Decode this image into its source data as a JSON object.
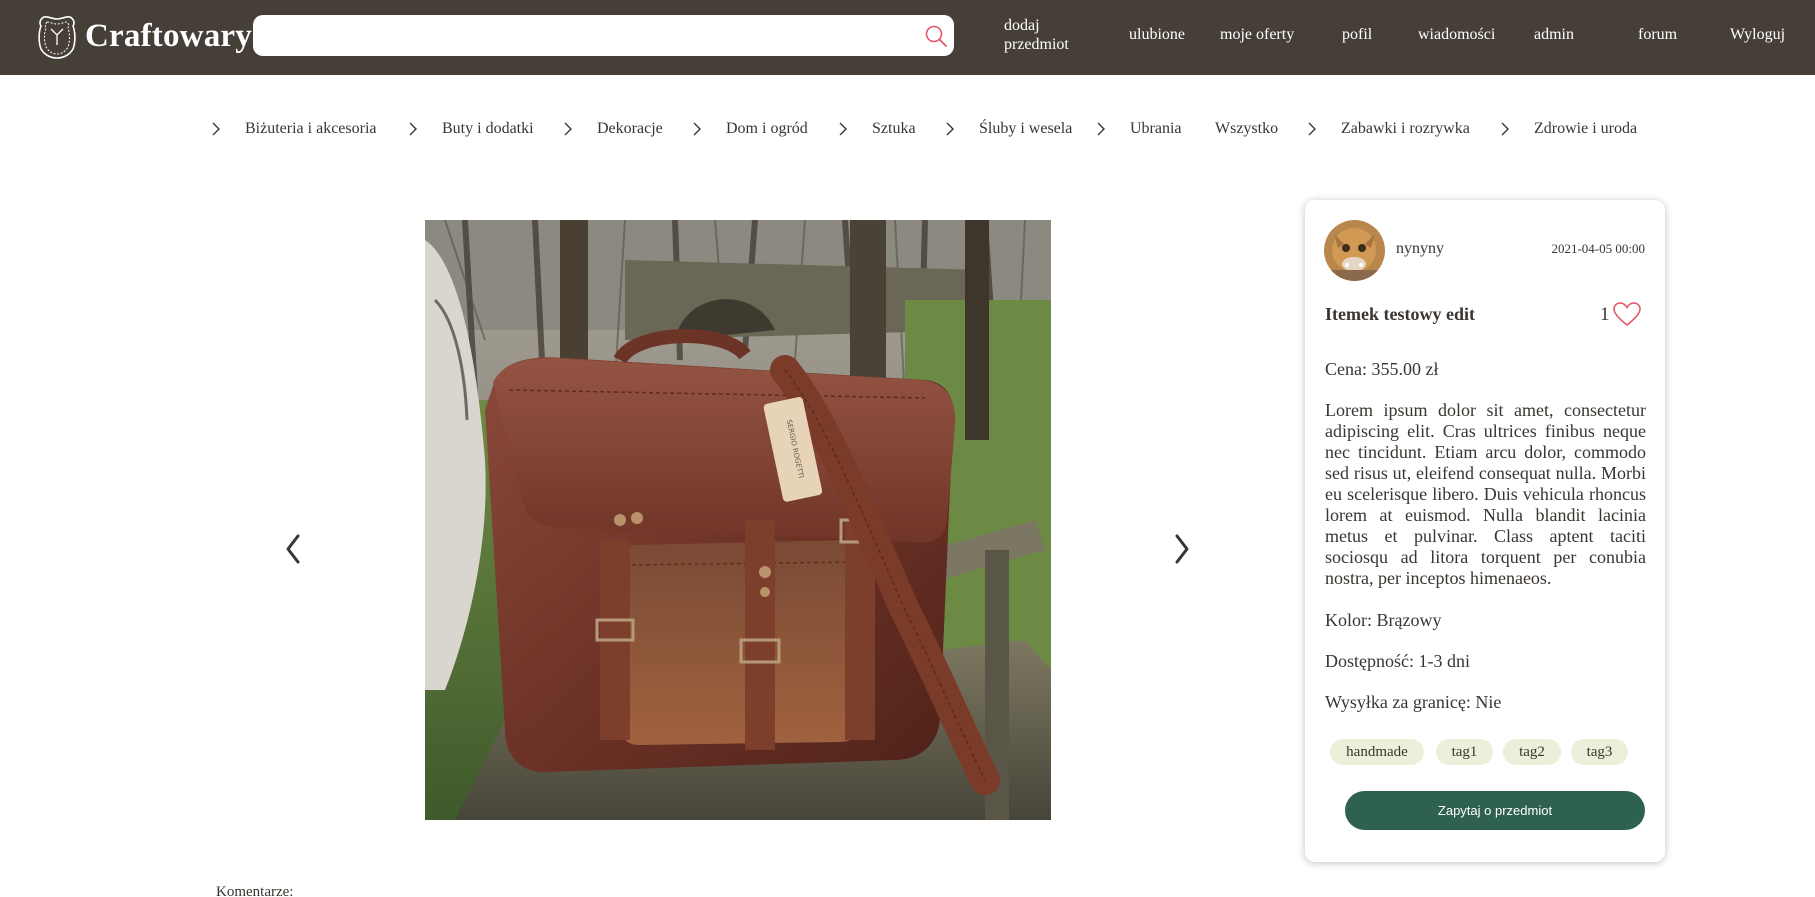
{
  "header": {
    "brand": "Craftowary",
    "search": {
      "value": "",
      "placeholder": ""
    },
    "nav": {
      "add_item": "dodaj przedmiot",
      "favorites": "ulubione",
      "my_offers": "moje oferty",
      "profile": "pofil",
      "messages": "wiadomości",
      "admin": "admin",
      "forum": "forum",
      "logout": "Wyloguj"
    }
  },
  "categories": [
    {
      "label": "Biżuteria i akcesoria",
      "chevron": true
    },
    {
      "label": "Buty i dodatki",
      "chevron": true
    },
    {
      "label": "Dekoracje",
      "chevron": true
    },
    {
      "label": "Dom i ogród",
      "chevron": true
    },
    {
      "label": "Sztuka",
      "chevron": true
    },
    {
      "label": "Śluby i wesela",
      "chevron": true
    },
    {
      "label": "Ubrania",
      "chevron": true
    },
    {
      "label": "Wszystko",
      "chevron": false
    },
    {
      "label": "Zabawki i rozrywka",
      "chevron": true
    },
    {
      "label": "Zdrowie i uroda",
      "chevron": true
    }
  ],
  "gallery": {
    "image_subject": "brown leather messenger bag on a wooden bench",
    "tag_text": "SERGIO ROGETTI"
  },
  "item": {
    "seller": "nynyny",
    "date": "2021-04-05 00:00",
    "title": "Itemek testowy edit",
    "likes": "1",
    "price": "Cena: 355.00 zł",
    "description": "Lorem ipsum dolor sit amet, consectetur adipiscing elit. Cras ultrices finibus neque nec tincidunt. Etiam arcu dolor, commodo sed risus ut, eleifend consequat nulla. Morbi eu scelerisque libero. Duis vehicula rhoncus lorem at euismod. Nulla blandit lacinia metus et pulvinar. Class aptent taciti sociosqu ad litora torquent per conubia nostra, per inceptos himenaeos.",
    "color": "Kolor: Brązowy",
    "availability": "Dostępność: 1-3 dni",
    "shipping_abroad": "Wysyłka za granicę: Nie",
    "tags": [
      "handmade",
      "tag1",
      "tag2",
      "tag3"
    ],
    "ask_button": "Zapytaj o przedmiot"
  },
  "comments_label": "Komentarze:",
  "colors": {
    "header_bg": "#463f38",
    "text": "#3a3530",
    "tag_bg": "#ecefd9",
    "button_bg": "#2f6150",
    "heart": "#e5566b"
  },
  "icons": [
    "logo-icon",
    "search-icon",
    "chevron-right-icon",
    "chevron-left-icon",
    "heart-icon"
  ]
}
